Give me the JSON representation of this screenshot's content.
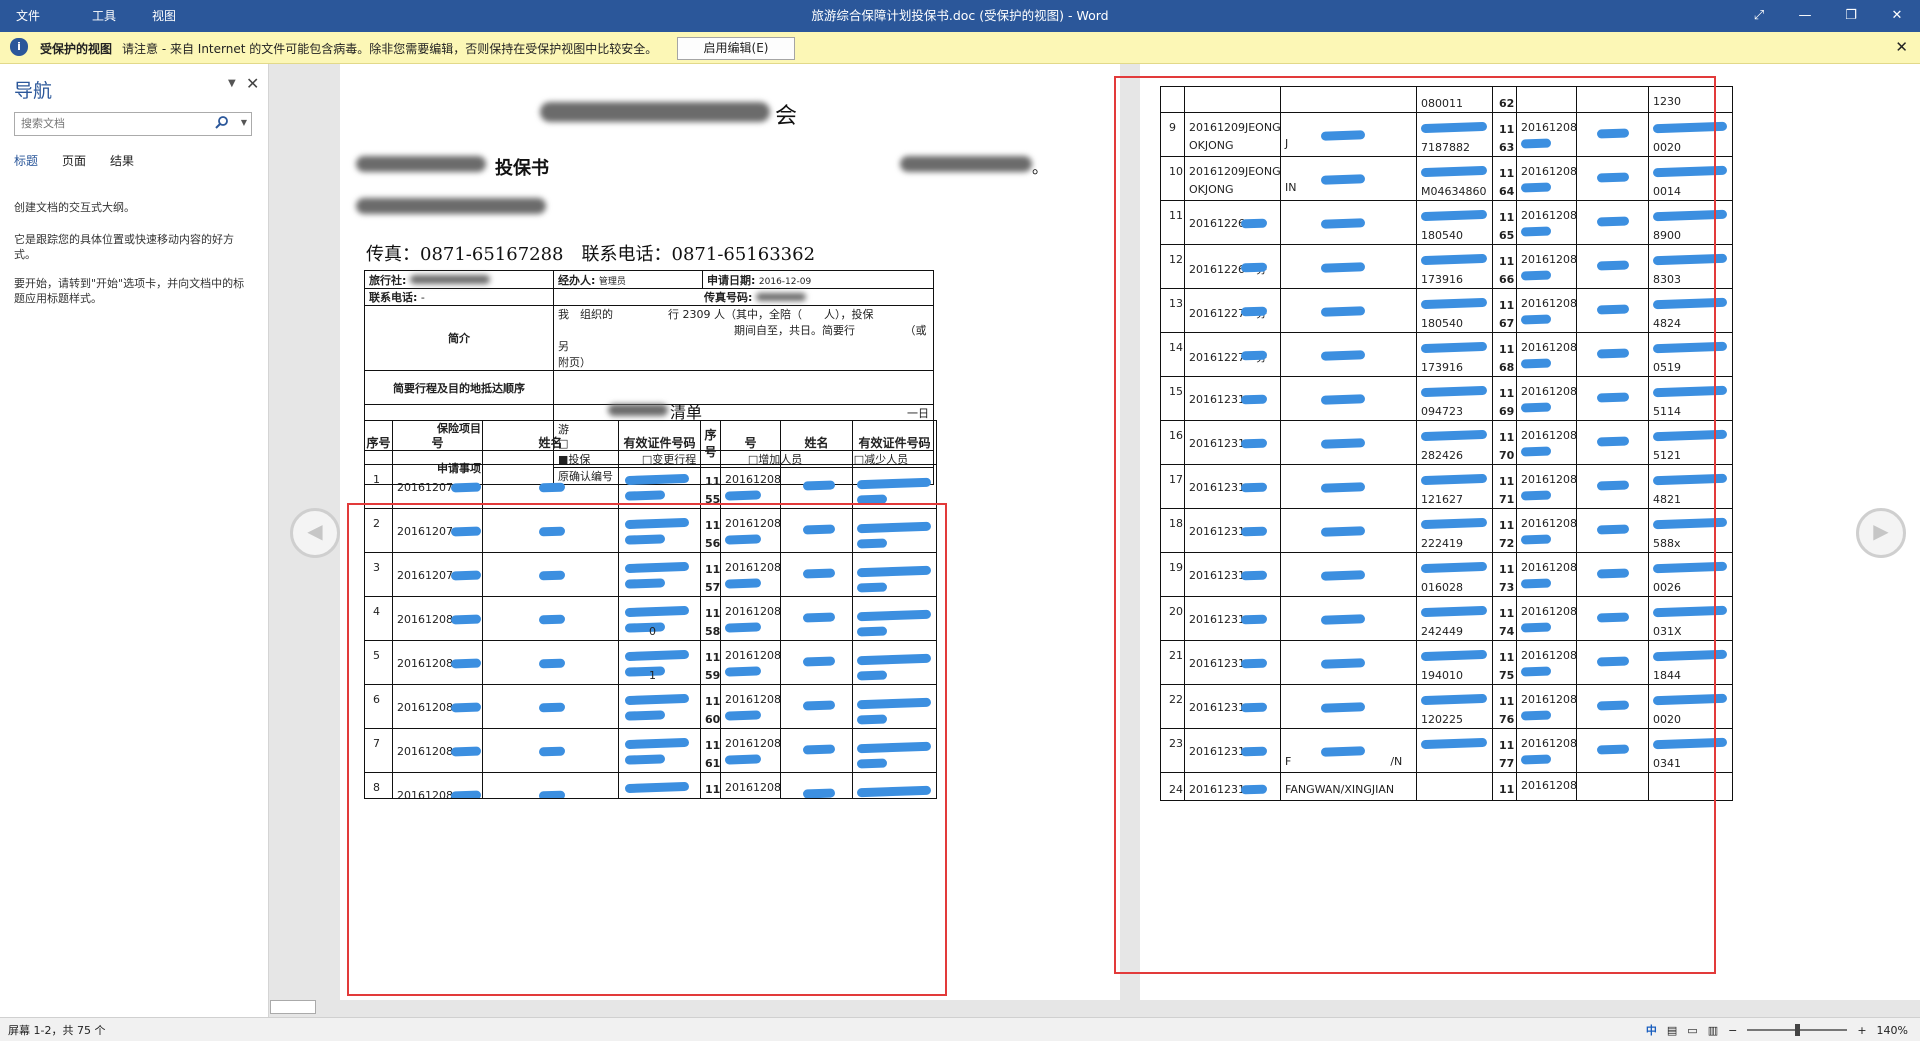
{
  "titlebar": {
    "menu": [
      "文件",
      "工具",
      "视图"
    ],
    "title": "旅游综合保障计划投保书.doc (受保护的视图) - Word"
  },
  "msgbar": {
    "title": "受保护的视图",
    "text": "请注意 - 来自 Internet 的文件可能包含病毒。除非您需要编辑，否则保持在受保护视图中比较安全。",
    "button": "启用编辑(E)"
  },
  "nav": {
    "title": "导航",
    "search_placeholder": "搜索文档",
    "tabs": [
      "标题",
      "页面",
      "结果"
    ],
    "p1": "创建文档的交互式大纲。",
    "p2": "它是跟踪您的具体位置或快速移动内容的好方式。",
    "p3": "要开始，请转到\"开始\"选项卡，并向文档中的标题应用标题样式。"
  },
  "page1": {
    "title_tail": "会",
    "subtitle": "投保书",
    "subtitle_right": "。",
    "fax": "传真：0871-65167288　联系电话：0871-65163362",
    "info": {
      "agency_label": "旅行社:",
      "handler_label": "经办人:",
      "handler_value": "管理员",
      "date_label": "申请日期:",
      "date_value": "2016-12-09",
      "phone_label": "联系电话:",
      "phone_value": "-",
      "fax_label": "传真号码:",
      "intro_label": "简介",
      "intro_line1": "我　组织的　　　　　行 2309 人（其中，全陪（　　人），投保",
      "intro_line2": "　　　　　　　　　　　　　　　　期间自至，共日。简要行　　　　　（或另",
      "intro_line3": "附页）",
      "itinerary_label": "简要行程及目的地抵达顺序",
      "insurance_label": "保险项目",
      "insurance_line1": "一日",
      "insurance_line2": "游",
      "insurance_line3": "□",
      "request_label": "申请事项",
      "opt1": "■投保",
      "opt2": "□变更行程",
      "opt3": "□增加人员",
      "opt4": "□减少人员",
      "confirm_label": "原确认编号"
    },
    "list_title": "清单",
    "headers": [
      "序号",
      "号",
      "姓名",
      "有效证件号码",
      "序号",
      "号",
      "姓名",
      "有效证件号码"
    ],
    "rows": [
      {
        "n": "1",
        "id": "20161207",
        "n2": "11",
        "n2b": "55",
        "id2": "20161208"
      },
      {
        "n": "2",
        "id": "20161207",
        "n2": "11",
        "n2b": "56",
        "id2": "20161208"
      },
      {
        "n": "3",
        "id": "20161207",
        "n2": "11",
        "n2b": "57",
        "id2": "20161208"
      },
      {
        "n": "4",
        "id": "20161208",
        "n2": "11",
        "n2b": "58",
        "id2": "20161208",
        "cert_tail": "0"
      },
      {
        "n": "5",
        "id": "20161208",
        "n2": "11",
        "n2b": "59",
        "id2": "20161208",
        "cert_tail": "1"
      },
      {
        "n": "6",
        "id": "20161208",
        "n2": "11",
        "n2b": "60",
        "id2": "20161208"
      },
      {
        "n": "7",
        "id": "20161208",
        "n2": "11",
        "n2b": "61",
        "id2": "20161208"
      },
      {
        "n": "8",
        "id": "20161208",
        "n2": "11",
        "n2b": "",
        "id2": "20161208"
      }
    ]
  },
  "page2": {
    "rows": [
      {
        "n": "",
        "id": "",
        "name": "",
        "cert": "080011",
        "n2": "62",
        "n2b": "",
        "id2": "",
        "cert2": "1230"
      },
      {
        "n": "9",
        "id": "20161209JEONG/SE",
        "id_b": "OKJONG",
        "name": "J",
        "cert": "7187882",
        "n2": "11",
        "n2b": "63",
        "id2": "20161208",
        "cert2": "0020"
      },
      {
        "n": "10",
        "id": "20161209JEONG/SE",
        "id_b": "OKJONG",
        "name": "IN",
        "cert": "M04634860",
        "n2": "11",
        "n2b": "64",
        "id2": "20161208",
        "cert2": "0014"
      },
      {
        "n": "11",
        "id": "20161226",
        "cert": "180540",
        "n2": "11",
        "n2b": "65",
        "id2": "20161208",
        "cert2": "8900"
      },
      {
        "n": "12",
        "id": "20161226　芬",
        "cert": "173916",
        "n2": "11",
        "n2b": "66",
        "id2": "20161208",
        "cert2": "8303"
      },
      {
        "n": "13",
        "id": "20161227　芬",
        "cert": "180540",
        "n2": "11",
        "n2b": "67",
        "id2": "20161208",
        "cert2": "4824"
      },
      {
        "n": "14",
        "id": "20161227　芬",
        "cert": "173916",
        "n2": "11",
        "n2b": "68",
        "id2": "20161208",
        "cert2": "0519"
      },
      {
        "n": "15",
        "id": "20161231",
        "cert": "094723",
        "n2": "11",
        "n2b": "69",
        "id2": "20161208",
        "cert2": "5114"
      },
      {
        "n": "16",
        "id": "20161231",
        "cert": "282426",
        "n2": "11",
        "n2b": "70",
        "id2": "20161208",
        "cert2": "5121"
      },
      {
        "n": "17",
        "id": "20161231",
        "cert": "121627",
        "n2": "11",
        "n2b": "71",
        "id2": "20161208",
        "cert2": "4821"
      },
      {
        "n": "18",
        "id": "20161231",
        "cert": "222419",
        "n2": "11",
        "n2b": "72",
        "id2": "20161208",
        "cert2": "588x"
      },
      {
        "n": "19",
        "id": "20161231",
        "cert": "016028",
        "n2": "11",
        "n2b": "73",
        "id2": "20161208",
        "cert2": "0026"
      },
      {
        "n": "20",
        "id": "20161231",
        "cert": "242449",
        "n2": "11",
        "n2b": "74",
        "id2": "20161208",
        "cert2": "031X"
      },
      {
        "n": "21",
        "id": "20161231",
        "cert": "194010",
        "n2": "11",
        "n2b": "75",
        "id2": "20161208",
        "cert2": "1844"
      },
      {
        "n": "22",
        "id": "20161231",
        "cert": "120225",
        "n2": "11",
        "n2b": "76",
        "id2": "20161208",
        "cert2": "0020"
      },
      {
        "n": "23",
        "id": "20161231",
        "name": "F　　　　　　　　　/N",
        "cert": "",
        "n2": "11",
        "n2b": "77",
        "id2": "20161208",
        "cert2": "0341"
      },
      {
        "n": "24",
        "id": "20161231",
        "name": "FANGWAN/XINGJIAN",
        "cert": "",
        "n2": "11",
        "n2b": "",
        "id2": "20161208",
        "cert2": ""
      }
    ]
  },
  "status": {
    "left": "屏幕 1-2，共 75 个",
    "zoom": "140%",
    "ime": "中"
  }
}
